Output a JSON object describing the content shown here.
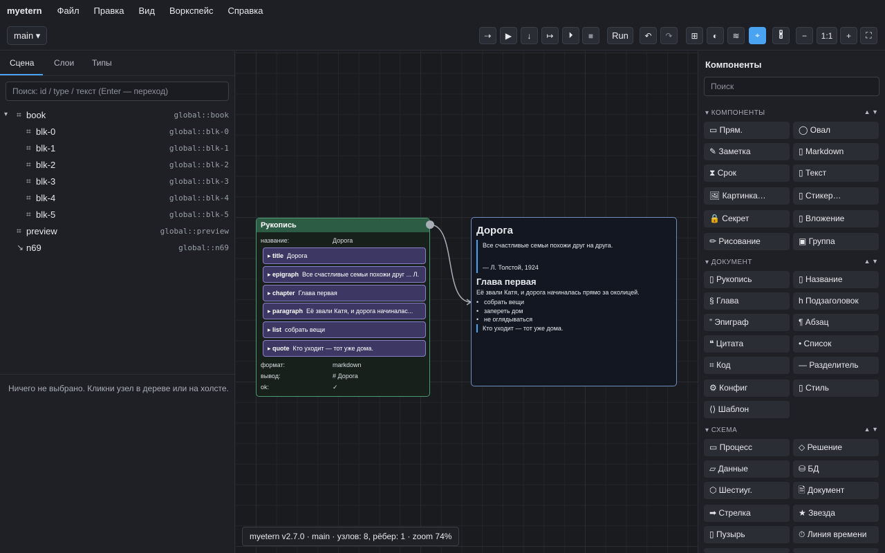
{
  "menubar": {
    "brand": "myetern",
    "items": [
      "Файл",
      "Правка",
      "Вид",
      "Воркспейс",
      "Справка"
    ]
  },
  "toolbar": {
    "branch": "main ▾",
    "buttons": [
      {
        "icon": "⇢",
        "name": "step-over-icon"
      },
      {
        "icon": "▶",
        "name": "play-icon"
      },
      {
        "icon": "↓",
        "name": "step-into-icon"
      },
      {
        "icon": "↦",
        "name": "step-out-icon"
      },
      {
        "icon": "⏵",
        "name": "continue-icon"
      },
      {
        "icon": "■",
        "name": "stop-icon"
      }
    ],
    "run_label": "Run",
    "undo": "↶",
    "redo": "↷",
    "view_icons": [
      "⊞",
      "◐",
      "≋",
      "⌖",
      "🖁"
    ],
    "zoom_out": "−",
    "zoom_reset": "1:1",
    "zoom_in": "+",
    "fit": "⛶"
  },
  "left": {
    "tabs": [
      "Сцена",
      "Слои",
      "Типы"
    ],
    "search_placeholder": "Поиск: id / type / текст (Enter — переход)",
    "tree": [
      {
        "caret": "▾",
        "icon": "⌗",
        "name": "book",
        "id": "global::book"
      },
      {
        "caret": "",
        "icon": "⌗",
        "name": "blk-0",
        "id": "global::blk-0"
      },
      {
        "caret": "",
        "icon": "⌗",
        "name": "blk-1",
        "id": "global::blk-1"
      },
      {
        "caret": "",
        "icon": "⌗",
        "name": "blk-2",
        "id": "global::blk-2"
      },
      {
        "caret": "",
        "icon": "⌗",
        "name": "blk-3",
        "id": "global::blk-3"
      },
      {
        "caret": "",
        "icon": "⌗",
        "name": "blk-4",
        "id": "global::blk-4"
      },
      {
        "caret": "",
        "icon": "⌗",
        "name": "blk-5",
        "id": "global::blk-5"
      },
      {
        "caret": "",
        "icon": "⌗",
        "name": "preview",
        "id": "global::preview"
      },
      {
        "caret": "",
        "icon": "↘",
        "name": "n69",
        "id": "global::n69"
      }
    ],
    "empty_message": "Ничего не выбрано. Кликни узел в дереве или на холсте."
  },
  "canvas": {
    "node": {
      "title": "Рукопись",
      "name_label": "название:",
      "name_value": "Дорога",
      "children": [
        {
          "type": "▸ title",
          "text": "Дорога"
        },
        {
          "type": "▸ epigraph",
          "text": "Все счастливые семьи похожи друг ... Л."
        },
        {
          "type": "▸ chapter",
          "text": "Глава первая"
        },
        {
          "type": "▸ paragraph",
          "text": "Её звали Катя, и дорога начиналас..."
        },
        {
          "type": "▸ list",
          "text": "собрать вещи"
        },
        {
          "type": "▸ quote",
          "text": "Кто уходит — тот уже дома."
        }
      ],
      "format_label": "формат:",
      "format_value": "markdown",
      "output_label": "вывод:",
      "output_value": "# Дорога",
      "ok_label": "ok:",
      "ok_value": "✓"
    },
    "preview": {
      "h1": "Дорога",
      "epigraph": "Все счастливые семьи похожи друг на друга.",
      "attribution": "— Л. Толстой, 1924",
      "h2": "Глава первая",
      "paragraph": "Её звали Катя, и дорога начиналась прямо за околицей.",
      "list": [
        "собрать вещи",
        "запереть дом",
        "не оглядываться"
      ],
      "quote": "Кто уходит — тот уже дома."
    },
    "status": "myetern v2.7.0 · main · узлов: 8, рёбер: 1 · zoom 74%"
  },
  "right": {
    "title": "Компоненты",
    "search_placeholder": "Поиск",
    "sections": [
      {
        "title": "▾ КОМПОНЕНТЫ",
        "arrows": "▲ ▼",
        "items": [
          "▭ Прям.",
          "◯ Овал",
          "✎ Заметка",
          "▯ Markdown",
          "⧗ Срок",
          "▯ Текст",
          "🖼 Картинка…",
          "▯ Стикер…",
          "🔒 Секрет",
          "▯ Вложение",
          "✏ Рисование",
          "▣ Группа"
        ]
      },
      {
        "title": "▾ ДОКУМЕНТ",
        "arrows": "▲ ▼",
        "items": [
          "▯ Рукопись",
          "▯ Название",
          "§ Глава",
          "h Подзаголовок",
          "” Эпиграф",
          "¶ Абзац",
          "❝ Цитата",
          "• Список",
          "⌗ Код",
          "— Разделитель",
          "⚙ Конфиг",
          "▯ Стиль",
          "⟨⟩ Шаблон"
        ]
      },
      {
        "title": "▾ СХЕМА",
        "arrows": "▲ ▼",
        "items": [
          "▭ Процесс",
          "◇ Решение",
          "▱ Данные",
          "⛁ БД",
          "⬡ Шестиуг.",
          "🖹 Документ",
          "➡ Стрелка",
          "★ Звезда",
          "▯ Пузырь",
          "⏱ Линия времени"
        ]
      }
    ]
  }
}
